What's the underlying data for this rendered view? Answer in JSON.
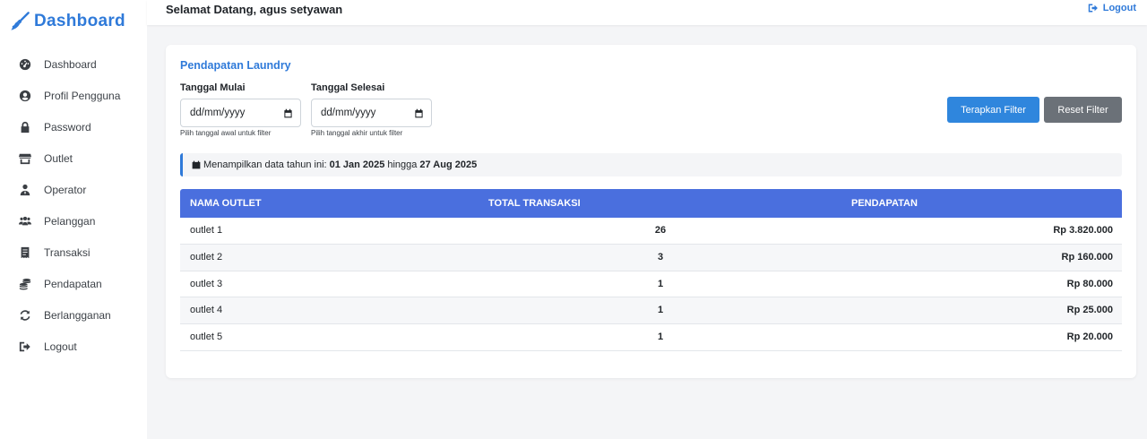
{
  "brand": {
    "title": "Dashboard"
  },
  "sidebar": {
    "items": [
      {
        "label": "Dashboard",
        "icon": "tachometer-icon"
      },
      {
        "label": "Profil Pengguna",
        "icon": "user-circle-icon"
      },
      {
        "label": "Password",
        "icon": "lock-icon"
      },
      {
        "label": "Outlet",
        "icon": "store-icon"
      },
      {
        "label": "Operator",
        "icon": "user-tie-icon"
      },
      {
        "label": "Pelanggan",
        "icon": "users-icon"
      },
      {
        "label": "Transaksi",
        "icon": "receipt-icon"
      },
      {
        "label": "Pendapatan",
        "icon": "coins-icon"
      },
      {
        "label": "Berlangganan",
        "icon": "sync-icon"
      },
      {
        "label": "Logout",
        "icon": "sign-out-icon"
      }
    ]
  },
  "topbar": {
    "welcome": "Selamat Datang, agus setyawan",
    "logout": "Logout"
  },
  "card": {
    "title": "Pendapatan Laundry",
    "start": {
      "label": "Tanggal Mulai",
      "value": "dd/mm/yyyy",
      "help": "Pilih tanggal awal untuk filter"
    },
    "end": {
      "label": "Tanggal Selesai",
      "value": "dd/mm/yyyy",
      "help": "Pilih tanggal akhir untuk filter"
    },
    "apply_label": "Terapkan Filter",
    "reset_label": "Reset Filter",
    "info": {
      "prefix": "Menampilkan data tahun ini:",
      "from": "01 Jan 2025",
      "mid": "hingga",
      "to": "27 Aug 2025"
    }
  },
  "table": {
    "headers": [
      "NAMA OUTLET",
      "TOTAL TRANSAKSI",
      "PENDAPATAN"
    ],
    "rows": [
      {
        "name": "outlet 1",
        "count": "26",
        "income": "Rp 3.820.000"
      },
      {
        "name": "outlet 2",
        "count": "3",
        "income": "Rp 160.000"
      },
      {
        "name": "outlet 3",
        "count": "1",
        "income": "Rp 80.000"
      },
      {
        "name": "outlet 4",
        "count": "1",
        "income": "Rp 25.000"
      },
      {
        "name": "outlet 5",
        "count": "1",
        "income": "Rp 20.000"
      }
    ]
  },
  "colors": {
    "accent": "#2f7ad9",
    "table_header": "#4a6fde",
    "reset": "#6b7178"
  }
}
